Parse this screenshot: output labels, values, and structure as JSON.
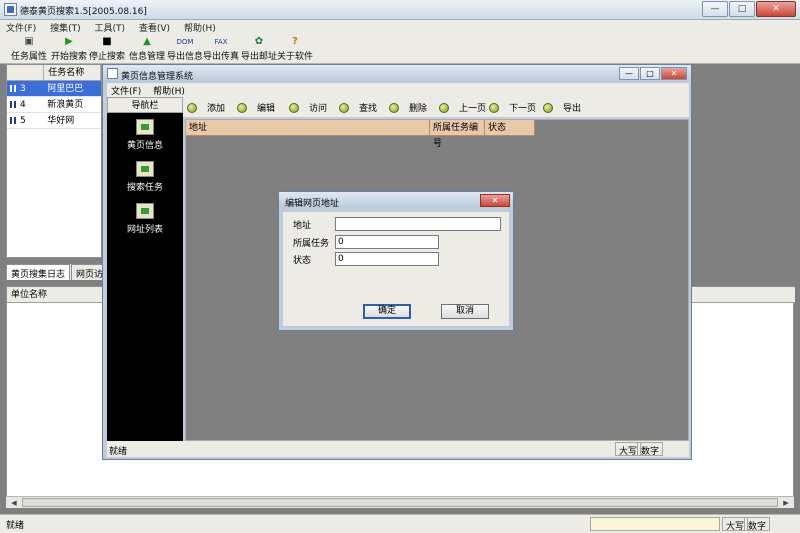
{
  "window": {
    "title": "德泰黄页搜索1.5[2005.08.16]",
    "min": "—",
    "max": "□",
    "close": "✕"
  },
  "menu": [
    "文件(F)",
    "搜集(T)",
    "工具(T)",
    "查看(V)",
    "帮助(H)"
  ],
  "toolbar": [
    {
      "label": "任务属性",
      "icon": "▣"
    },
    {
      "label": "开始搜索",
      "icon": "▶"
    },
    {
      "label": "停止搜索",
      "icon": "■"
    },
    {
      "label": "信息管理",
      "icon": "▲"
    },
    {
      "label": "导出信息",
      "icon": "DOM"
    },
    {
      "label": "导出传真",
      "icon": "FAX"
    },
    {
      "label": "导出邮址",
      "icon": "✿"
    },
    {
      "label": "关于软件",
      "icon": "?"
    }
  ],
  "tasks": {
    "header": [
      "",
      "任务名称"
    ],
    "rows": [
      {
        "id": "3",
        "name": "阿里巴巴"
      },
      {
        "id": "4",
        "name": "新浪黄页"
      },
      {
        "id": "5",
        "name": "华好网"
      }
    ]
  },
  "tabs": [
    "黄页搜集日志",
    "网页访问"
  ],
  "log": {
    "header": "单位名称"
  },
  "status": {
    "text": "就绪",
    "caps": "大写",
    "num": "数字"
  },
  "inner": {
    "title": "黄页信息管理系统",
    "menu": [
      "文件(F)",
      "帮助(H)"
    ],
    "nav_title": "导航栏",
    "nav": [
      "黄页信息",
      "搜索任务",
      "网址列表"
    ],
    "toolbar": [
      "添加",
      "编辑",
      "访问",
      "查找",
      "删除",
      "上一页",
      "下一页",
      "导出"
    ],
    "grid_headers": [
      "地址",
      "所属任务编号",
      "状态"
    ],
    "status": {
      "text": "就绪",
      "caps": "大写",
      "num": "数字"
    }
  },
  "dialog": {
    "title": "编辑网页地址",
    "close": "✕",
    "fields": {
      "address": {
        "label": "地址",
        "value": ""
      },
      "task": {
        "label": "所属任务",
        "value": "0"
      },
      "state": {
        "label": "状态",
        "value": "0"
      }
    },
    "ok": "确定",
    "cancel": "取消"
  }
}
